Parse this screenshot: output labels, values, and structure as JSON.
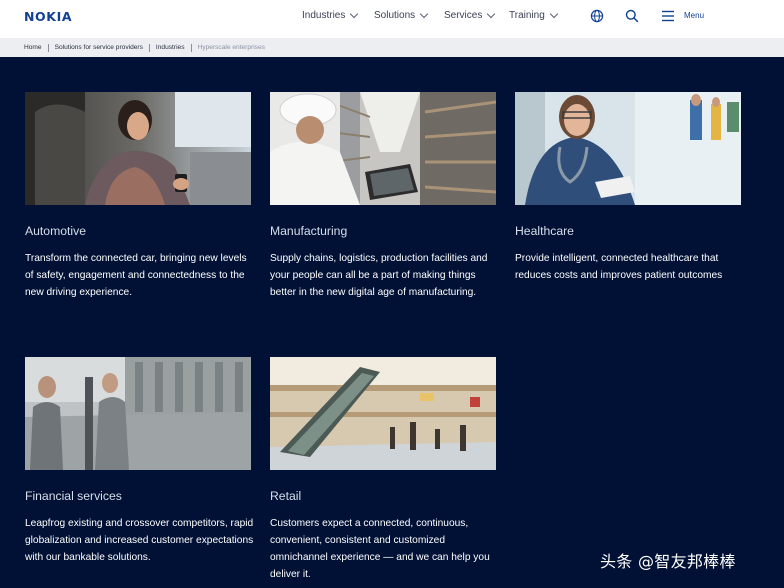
{
  "brand": {
    "logo_text": "NOKIA",
    "color": "#124191"
  },
  "nav": {
    "items": [
      {
        "label": "Industries"
      },
      {
        "label": "Solutions"
      },
      {
        "label": "Services"
      },
      {
        "label": "Training"
      }
    ],
    "icons": [
      "globe-icon",
      "search-icon",
      "hamburger-menu-icon"
    ],
    "menu_label": "Menu"
  },
  "breadcrumb": [
    "Home",
    "Solutions for service providers",
    "Industries",
    "Hyperscale enterprises"
  ],
  "colors": {
    "page_background": "#001135",
    "breadcrumb_background": "#eceef2",
    "header_background": "#ffffff"
  },
  "cards": [
    {
      "title": "Automotive",
      "description": "Transform the connected car, bringing new levels of safety, engagement and connectedness to the new driving experience.",
      "image": "woman-in-car-with-phone"
    },
    {
      "title": "Manufacturing",
      "description": "Supply chains, logistics, production facilities and your people can all be a part of making things better in the new digital age of manufacturing.",
      "image": "worker-in-warehouse-with-tablet"
    },
    {
      "title": "Healthcare",
      "description": "Provide intelligent, connected healthcare that reduces costs and improves patient outcomes",
      "image": "nurse-with-stethoscope"
    },
    {
      "title": "Financial services",
      "description": "Leapfrog existing and crossover competitors, rapid globalization and increased customer expectations with our bankable solutions.",
      "image": "businessmen-at-atm"
    },
    {
      "title": "Retail",
      "description": "Customers expect a connected, continuous, convenient, consistent and customized omnichannel experience — and we can help you deliver it.",
      "image": "shopping-mall-escalators"
    }
  ],
  "watermark": "头条 @智友邦棒棒"
}
